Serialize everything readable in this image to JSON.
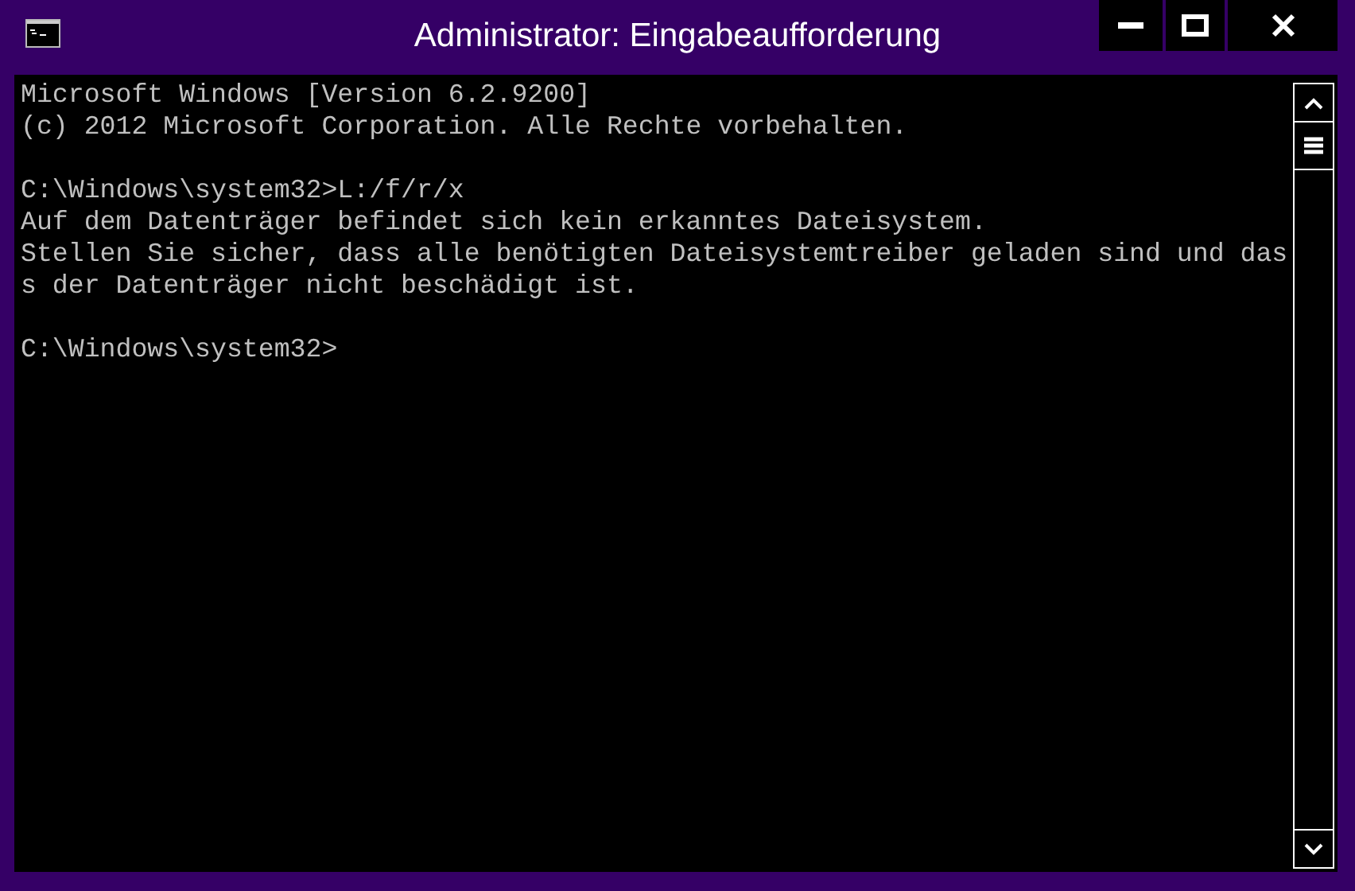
{
  "window": {
    "title": "Administrator: Eingabeaufforderung"
  },
  "console": {
    "blocks": [
      [
        "Microsoft Windows [Version 6.2.9200]",
        "(c) 2012 Microsoft Corporation. Alle Rechte vorbehalten."
      ],
      [
        "C:\\Windows\\system32>L:/f/r/x",
        "Auf dem Datenträger befindet sich kein erkanntes Dateisystem.",
        "Stellen Sie sicher, dass alle benötigten Dateisystemtreiber geladen sind und das",
        "s der Datenträger nicht beschädigt ist."
      ],
      [
        "C:\\Windows\\system32>"
      ]
    ]
  }
}
